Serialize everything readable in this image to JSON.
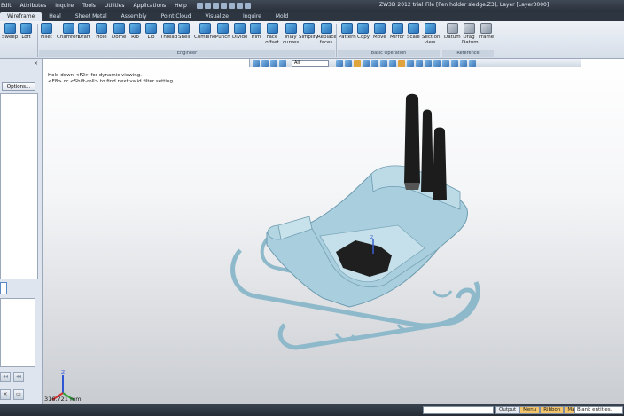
{
  "title": {
    "app": "ZW3D 2012 trial",
    "file": "File [Pen holder sledge.Z3],  Layer [Layer0000]"
  },
  "menu": [
    "Edit",
    "Attributes",
    "Inquire",
    "Tools",
    "Utilities",
    "Applications",
    "Help"
  ],
  "tabs": [
    "Wireframe",
    "Heal",
    "Sheet Metal",
    "Assembly",
    "Point Cloud",
    "Visualize",
    "Inquire",
    "Mold"
  ],
  "active_tab": "Wireframe",
  "ribbon": {
    "buttons_left": [
      "Sweep",
      "Loft"
    ],
    "buttons_engineering": [
      "Fillet",
      "Chamfers",
      "Draft",
      "Hole",
      "Dome",
      "Rib",
      "Lip",
      "Thread",
      "Shell",
      "Combine",
      "Punch",
      "Divide",
      "Trim",
      "Face offset",
      "Inlay curves",
      "Simplify",
      "Replace faces"
    ],
    "group_engineering": "Engineer",
    "buttons_basic": [
      "Pattern",
      "Copy",
      "Move",
      "Mirror",
      "Scale",
      "Section view"
    ],
    "group_basic": "Basic Operation",
    "buttons_reference": [
      "Datum",
      "Drag Datum",
      "Frame"
    ],
    "group_reference": "Reference"
  },
  "left_panel": {
    "options_label": "Options..."
  },
  "viewport": {
    "hint_line1": "Hold down <F2> for dynamic viewing.",
    "hint_line2": "<F8> or <Shift-roll> to find next valid filter setting.",
    "filter_value": "All",
    "scale_readout": "316.721 mm"
  },
  "status": {
    "output": "Output",
    "tabs": [
      "Menu",
      "Ribbon",
      "Manager"
    ],
    "highlighted": "Ribbon",
    "message": "Blank entities."
  },
  "colors": {
    "model_body": "#a9cfdf",
    "pen_black": "#1c1c1c",
    "accent": "#f3c46a"
  },
  "icons": [
    "file-new-icon",
    "open-icon",
    "save-icon",
    "undo-icon",
    "redo-icon",
    "axis-triad-icon"
  ]
}
